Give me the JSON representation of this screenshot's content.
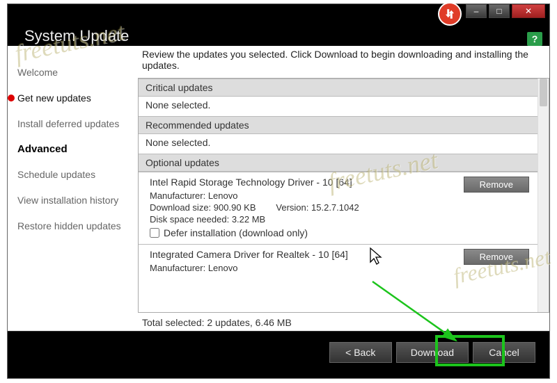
{
  "app": {
    "title": "System Update"
  },
  "window_controls": {
    "min": "–",
    "max": "□",
    "close": "✕"
  },
  "help": {
    "label": "?"
  },
  "sidebar": {
    "items": [
      {
        "label": "Welcome"
      },
      {
        "label": "Get new updates"
      },
      {
        "label": "Install deferred updates"
      }
    ],
    "heading": "Advanced",
    "advanced_items": [
      {
        "label": "Schedule updates"
      },
      {
        "label": "View installation history"
      },
      {
        "label": "Restore hidden updates"
      }
    ]
  },
  "main": {
    "instruction": "Review the updates you selected. Click Download to begin downloading and installing the updates.",
    "sections": {
      "critical": {
        "header": "Critical updates",
        "body": "None selected."
      },
      "recommended": {
        "header": "Recommended updates",
        "body": "None selected."
      },
      "optional": {
        "header": "Optional updates"
      }
    },
    "updates": [
      {
        "title": "Intel Rapid Storage Technology Driver - 10 [64]",
        "manufacturer_label": "Manufacturer:",
        "manufacturer": "Lenovo",
        "download_label": "Download size:",
        "download_size": "900.90 KB",
        "version_label": "Version:",
        "version": "15.2.7.1042",
        "disk_label": "Disk space needed:",
        "disk": "3.22 MB",
        "defer_label": "Defer installation (download only)",
        "remove_label": "Remove"
      },
      {
        "title": "Integrated Camera Driver for Realtek - 10 [64]",
        "manufacturer_label": "Manufacturer:",
        "manufacturer": "Lenovo",
        "remove_label": "Remove"
      }
    ],
    "summary": "Total selected: 2 updates,  6.46 MB"
  },
  "footer": {
    "back": "<  Back",
    "download": "Download",
    "cancel": "Cancel"
  },
  "watermark": "freetuts.net"
}
